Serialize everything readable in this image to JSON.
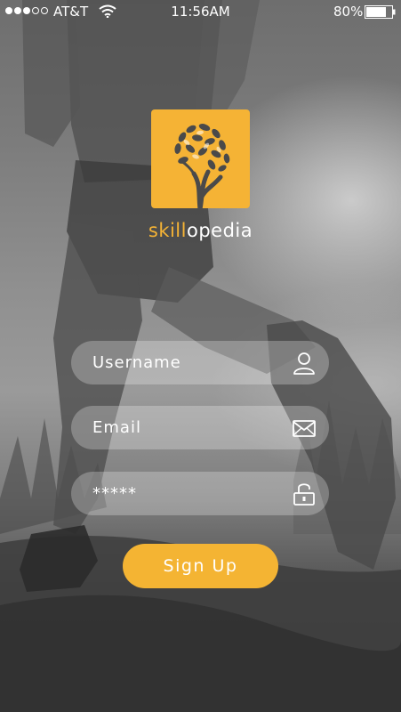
{
  "status_bar": {
    "carrier": "AT&T",
    "time": "11:56AM",
    "battery_percent": "80%",
    "signal_bars_filled": 3,
    "signal_bars_total": 5,
    "battery_level": 0.8
  },
  "brand": {
    "name_part1": "skill",
    "name_part2": "opedia",
    "accent_color": "#f5b335"
  },
  "form": {
    "username": {
      "placeholder": "Username",
      "value": "",
      "icon": "user-icon"
    },
    "email": {
      "placeholder": "Email",
      "value": "",
      "icon": "envelope-icon"
    },
    "password": {
      "placeholder": "*****",
      "value": "",
      "icon": "unlock-icon"
    },
    "submit_label": "Sign Up"
  }
}
